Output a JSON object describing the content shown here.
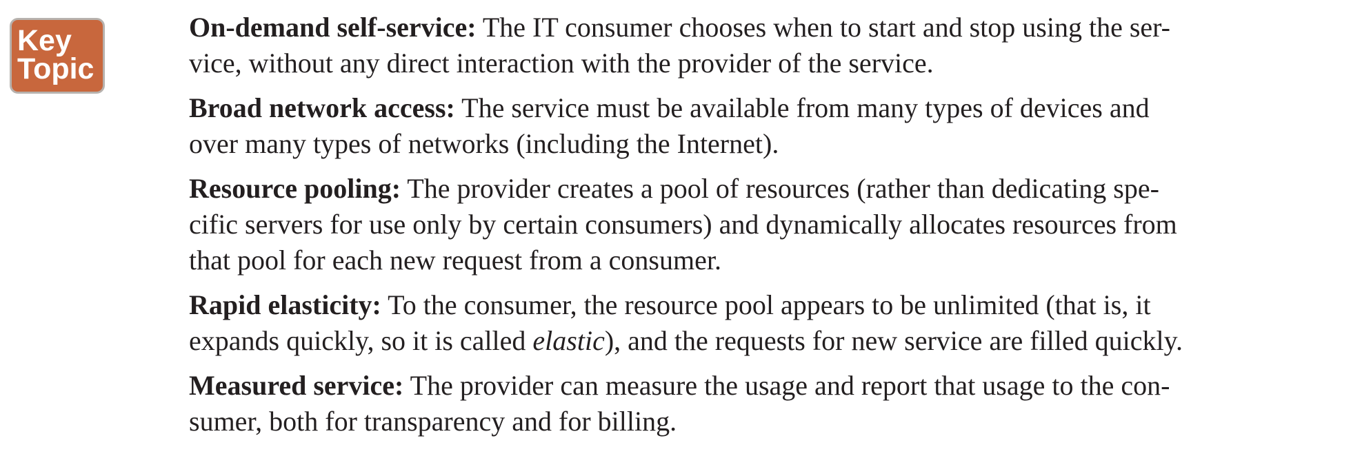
{
  "badge": {
    "line1": "Key",
    "line2": "Topic",
    "color": "#c8673d",
    "border_color": "#b7b2ae"
  },
  "definitions": [
    {
      "term": "On-demand self-service:",
      "line1": " The IT consumer chooses when to start and stop using the ser-",
      "line2": "vice, without any direct interaction with the provider of the service."
    },
    {
      "term": "Broad network access:",
      "line1": " The service must be available from many types of devices and",
      "line2": "over many types of networks (including the Internet)."
    },
    {
      "term": "Resource pooling:",
      "line1": " The provider creates a pool of resources (rather than dedicating spe-",
      "line2": "cific servers for use only by certain consumers) and dynamically allocates resources from",
      "line3": "that pool for each new request from a consumer."
    },
    {
      "term": "Rapid elasticity:",
      "line1": " To the consumer, the resource pool appears to be unlimited (that is, it",
      "line2_a": "expands quickly, so it is called ",
      "line2_em": "elastic",
      "line2_b": "), and the requests for new service are filled quickly."
    },
    {
      "term": "Measured service:",
      "line1": " The provider can measure the usage and report that usage to the con-",
      "line2": "sumer, both for transparency and for billing."
    }
  ]
}
